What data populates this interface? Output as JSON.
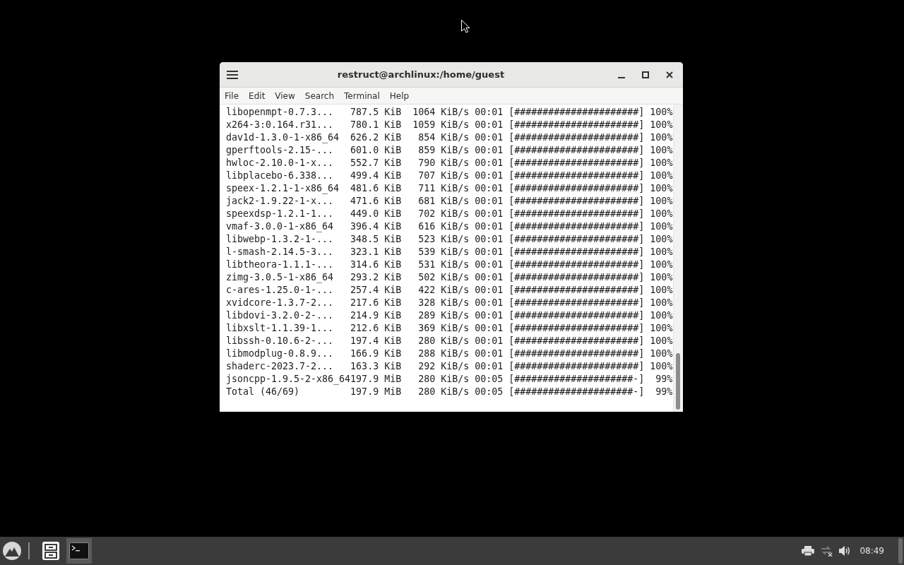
{
  "window": {
    "title": "restruct@archlinux:/home/guest"
  },
  "menu": [
    "File",
    "Edit",
    "View",
    "Search",
    "Terminal",
    "Help"
  ],
  "terminal": {
    "rows": [
      {
        "name": "libopenmpt-0.7.3...",
        "size": "787.5 KiB",
        "rate": "1064 KiB/s",
        "time": "00:01",
        "bar": "[######################]",
        "percent": "100%"
      },
      {
        "name": "x264-3:0.164.r31...",
        "size": "780.1 KiB",
        "rate": "1059 KiB/s",
        "time": "00:01",
        "bar": "[######################]",
        "percent": "100%"
      },
      {
        "name": "dav1d-1.3.0-1-x86_64",
        "size": "626.2 KiB",
        "rate": "854 KiB/s",
        "time": "00:01",
        "bar": "[######################]",
        "percent": "100%"
      },
      {
        "name": "gperftools-2.15-...",
        "size": "601.0 KiB",
        "rate": "859 KiB/s",
        "time": "00:01",
        "bar": "[######################]",
        "percent": "100%"
      },
      {
        "name": "hwloc-2.10.0-1-x...",
        "size": "552.7 KiB",
        "rate": "790 KiB/s",
        "time": "00:01",
        "bar": "[######################]",
        "percent": "100%"
      },
      {
        "name": "libplacebo-6.338...",
        "size": "499.4 KiB",
        "rate": "707 KiB/s",
        "time": "00:01",
        "bar": "[######################]",
        "percent": "100%"
      },
      {
        "name": "speex-1.2.1-1-x86_64",
        "size": "481.6 KiB",
        "rate": "711 KiB/s",
        "time": "00:01",
        "bar": "[######################]",
        "percent": "100%"
      },
      {
        "name": "jack2-1.9.22-1-x...",
        "size": "471.6 KiB",
        "rate": "681 KiB/s",
        "time": "00:01",
        "bar": "[######################]",
        "percent": "100%"
      },
      {
        "name": "speexdsp-1.2.1-1...",
        "size": "449.0 KiB",
        "rate": "702 KiB/s",
        "time": "00:01",
        "bar": "[######################]",
        "percent": "100%"
      },
      {
        "name": "vmaf-3.0.0-1-x86_64",
        "size": "396.4 KiB",
        "rate": "616 KiB/s",
        "time": "00:01",
        "bar": "[######################]",
        "percent": "100%"
      },
      {
        "name": "libwebp-1.3.2-1-...",
        "size": "348.5 KiB",
        "rate": "523 KiB/s",
        "time": "00:01",
        "bar": "[######################]",
        "percent": "100%"
      },
      {
        "name": "l-smash-2.14.5-3...",
        "size": "323.1 KiB",
        "rate": "539 KiB/s",
        "time": "00:01",
        "bar": "[######################]",
        "percent": "100%"
      },
      {
        "name": "libtheora-1.1.1-...",
        "size": "314.6 KiB",
        "rate": "531 KiB/s",
        "time": "00:01",
        "bar": "[######################]",
        "percent": "100%"
      },
      {
        "name": "zimg-3.0.5-1-x86_64",
        "size": "293.2 KiB",
        "rate": "502 KiB/s",
        "time": "00:01",
        "bar": "[######################]",
        "percent": "100%"
      },
      {
        "name": "c-ares-1.25.0-1-...",
        "size": "257.4 KiB",
        "rate": "422 KiB/s",
        "time": "00:01",
        "bar": "[######################]",
        "percent": "100%"
      },
      {
        "name": "xvidcore-1.3.7-2...",
        "size": "217.6 KiB",
        "rate": "328 KiB/s",
        "time": "00:01",
        "bar": "[######################]",
        "percent": "100%"
      },
      {
        "name": "libdovi-3.2.0-2-...",
        "size": "214.9 KiB",
        "rate": "289 KiB/s",
        "time": "00:01",
        "bar": "[######################]",
        "percent": "100%"
      },
      {
        "name": "libxslt-1.1.39-1...",
        "size": "212.6 KiB",
        "rate": "369 KiB/s",
        "time": "00:01",
        "bar": "[######################]",
        "percent": "100%"
      },
      {
        "name": "libssh-0.10.6-2-...",
        "size": "197.4 KiB",
        "rate": "280 KiB/s",
        "time": "00:01",
        "bar": "[######################]",
        "percent": "100%"
      },
      {
        "name": "libmodplug-0.8.9...",
        "size": "166.9 KiB",
        "rate": "288 KiB/s",
        "time": "00:01",
        "bar": "[######################]",
        "percent": "100%"
      },
      {
        "name": "shaderc-2023.7-2...",
        "size": "163.3 KiB",
        "rate": "292 KiB/s",
        "time": "00:01",
        "bar": "[######################]",
        "percent": "100%"
      },
      {
        "name": "jsoncpp-1.9.5-2-x86_64",
        "size": "197.9 MiB",
        "rate": "280 KiB/s",
        "time": "00:05",
        "bar": "[#####################-]",
        "percent": "99%"
      },
      {
        "name": "Total (46/69)",
        "size": "197.9 MiB",
        "rate": "280 KiB/s",
        "time": "00:05",
        "bar": "[#####################-]",
        "percent": "99%"
      }
    ]
  },
  "taskbar": {
    "apps": [
      {
        "kind": "files",
        "selected": false
      },
      {
        "kind": "terminal",
        "selected": true
      }
    ],
    "clock": "08:49"
  }
}
